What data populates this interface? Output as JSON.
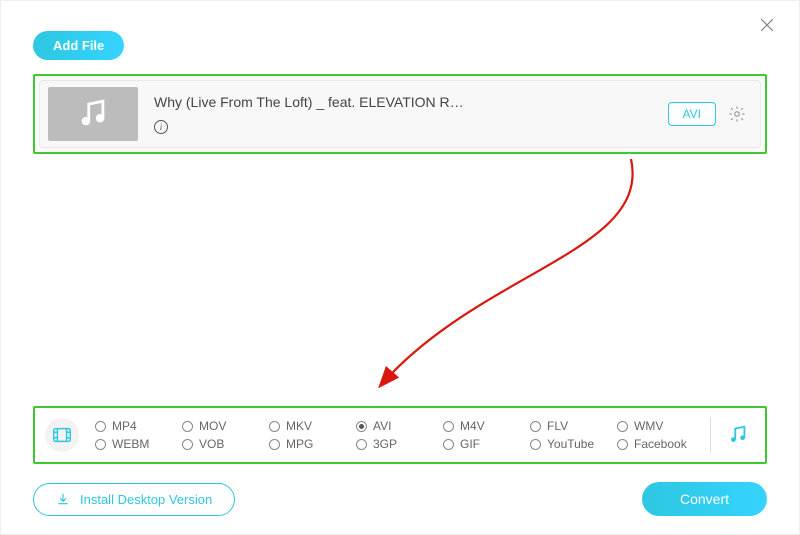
{
  "header": {
    "add_file_label": "Add File"
  },
  "file": {
    "title": "Why (Live From The Loft) _ feat. ELEVATION R…",
    "selected_format": "AVI"
  },
  "formats": {
    "row1": [
      "MP4",
      "MOV",
      "MKV",
      "AVI",
      "M4V",
      "FLV",
      "WMV"
    ],
    "row2": [
      "WEBM",
      "VOB",
      "MPG",
      "3GP",
      "GIF",
      "YouTube",
      "Facebook"
    ],
    "selected": "AVI"
  },
  "footer": {
    "install_label": "Install Desktop Version",
    "convert_label": "Convert"
  }
}
